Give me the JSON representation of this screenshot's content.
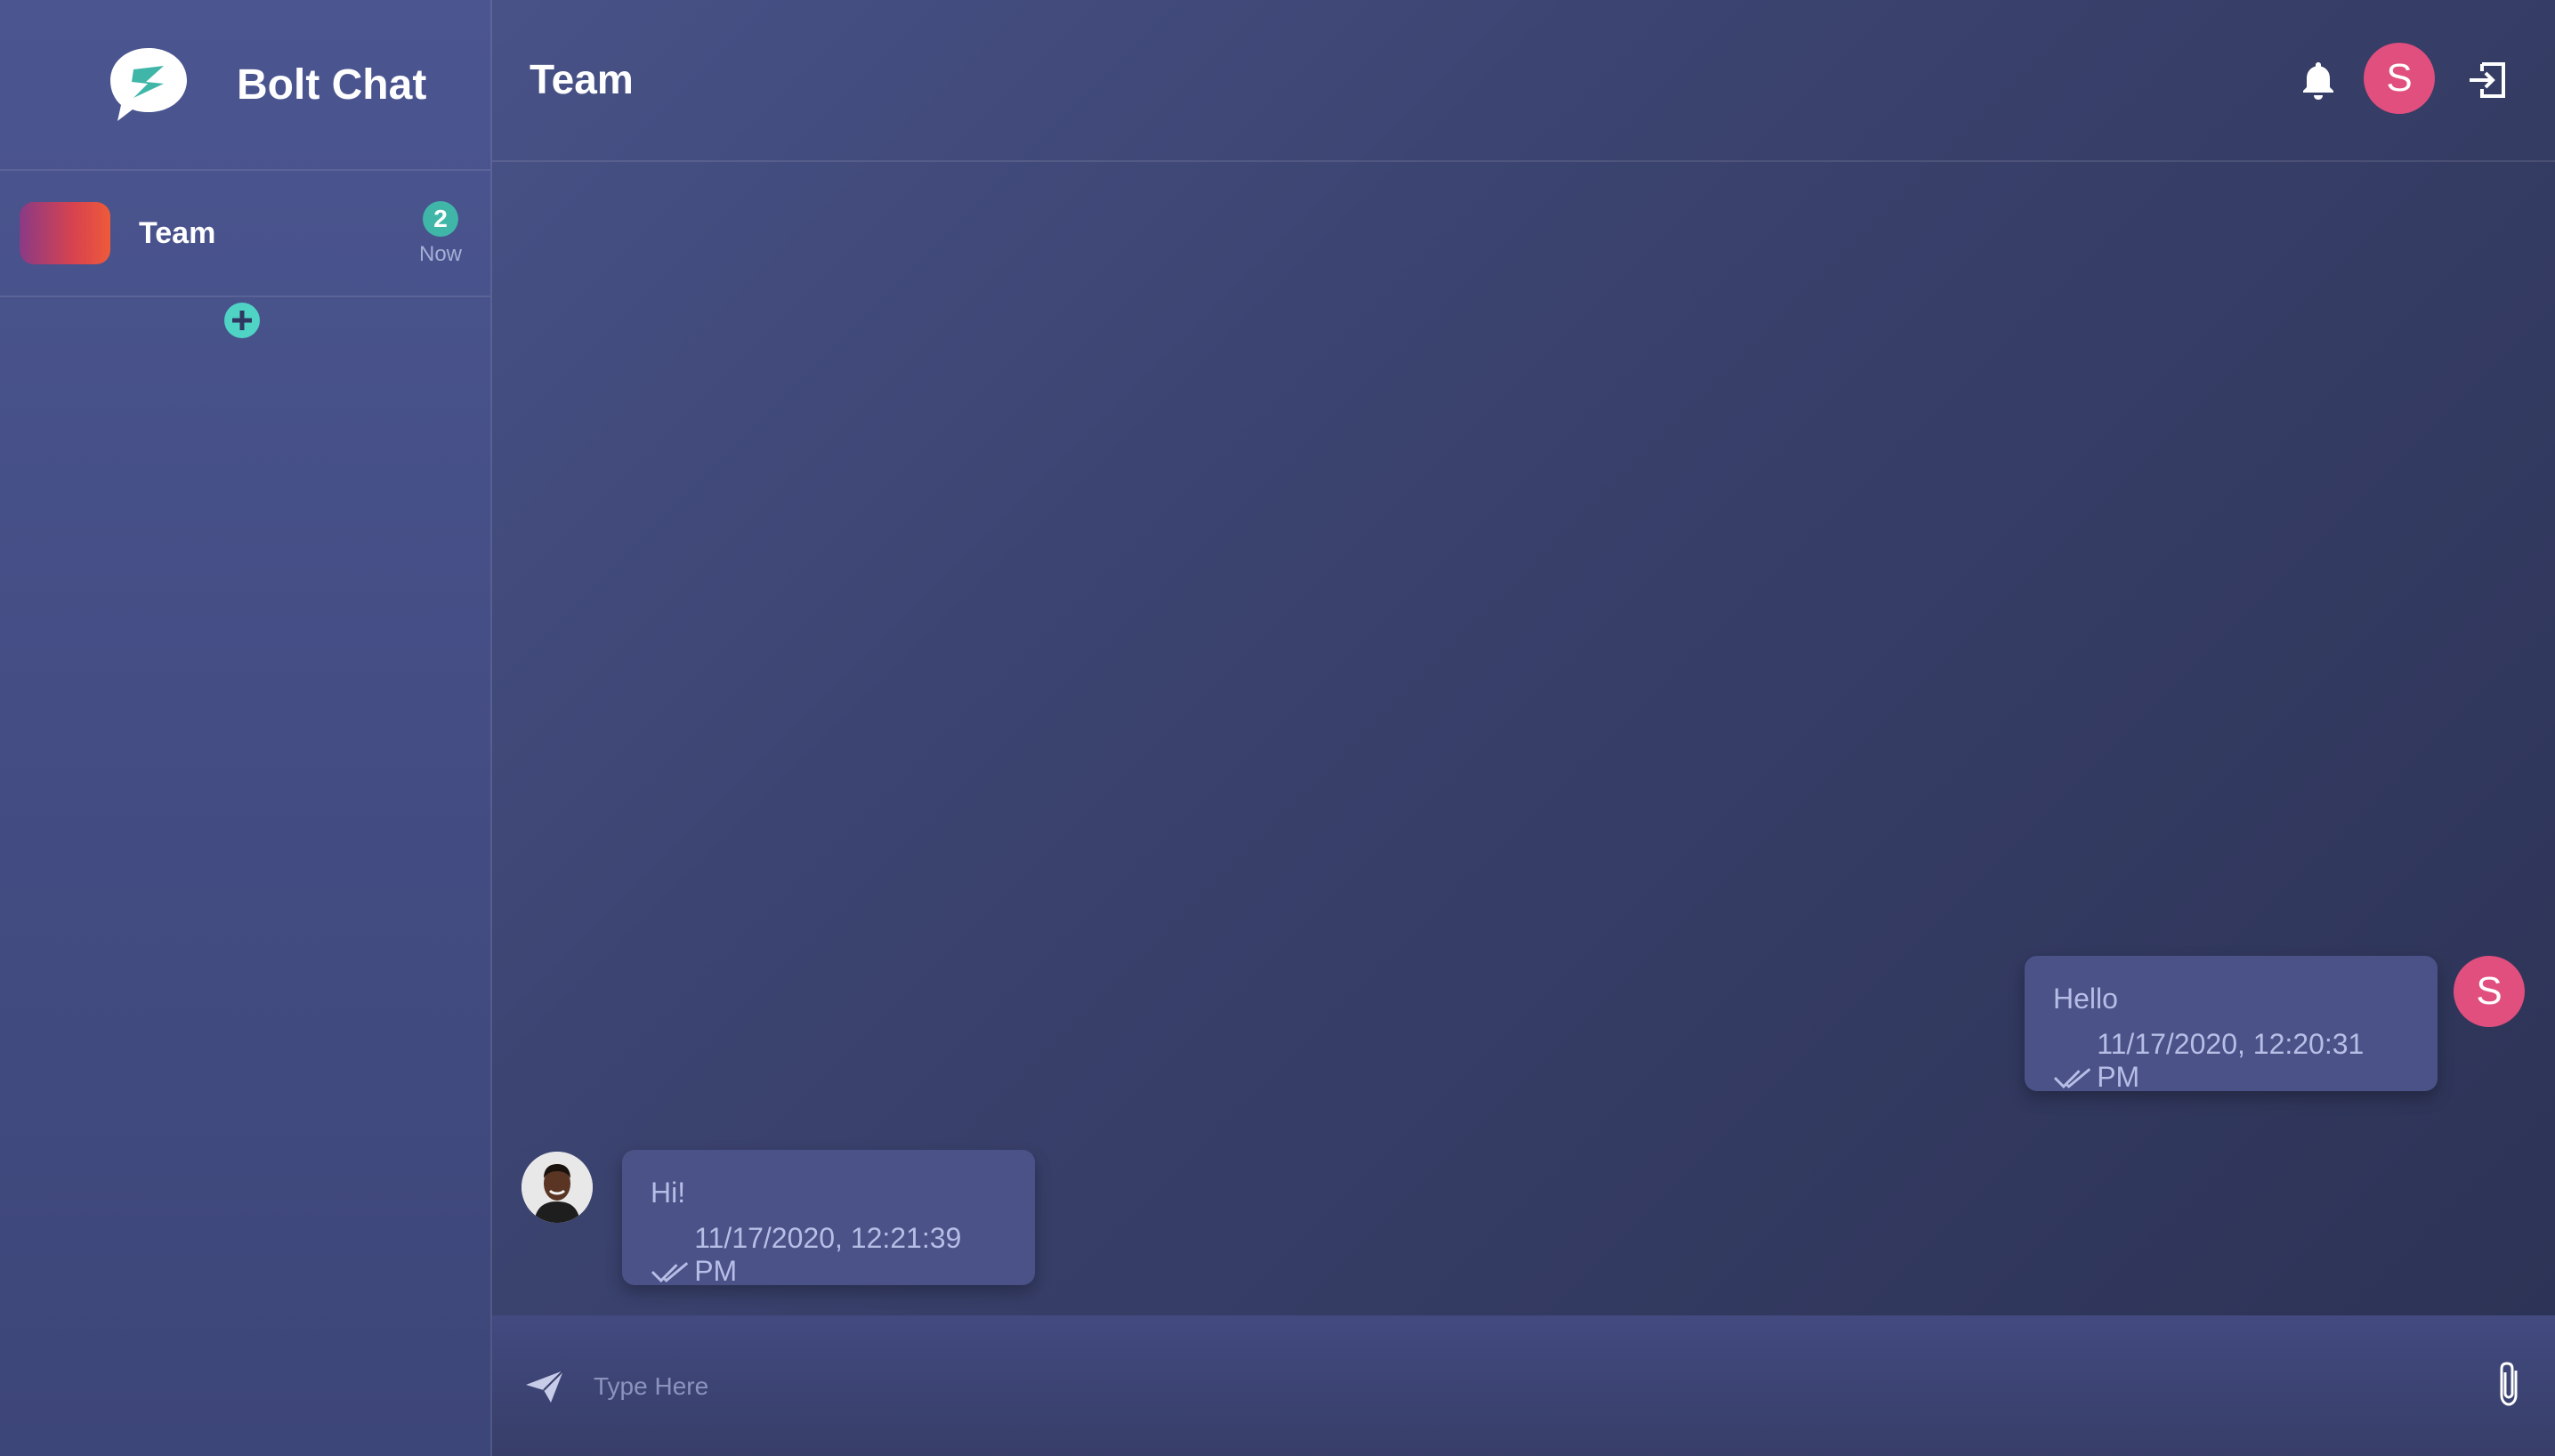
{
  "app": {
    "name": "Bolt Chat"
  },
  "sidebar": {
    "chats": [
      {
        "name": "Team",
        "unread": "2",
        "time": "Now"
      }
    ]
  },
  "header": {
    "title": "Team",
    "user_initial": "S"
  },
  "messages": [
    {
      "text": "Hello",
      "timestamp": "11/17/2020, 12:20:31 PM",
      "sender_initial": "S",
      "side": "right"
    },
    {
      "text": "Hi!",
      "timestamp": "11/17/2020, 12:21:39 PM",
      "sender_initial": "",
      "side": "left"
    }
  ],
  "composer": {
    "placeholder": "Type Here"
  },
  "colors": {
    "accent": "#4fd3c4",
    "avatar": "#e04f7d",
    "bubble": "#4a5288",
    "badge": "#3fb6a8"
  }
}
